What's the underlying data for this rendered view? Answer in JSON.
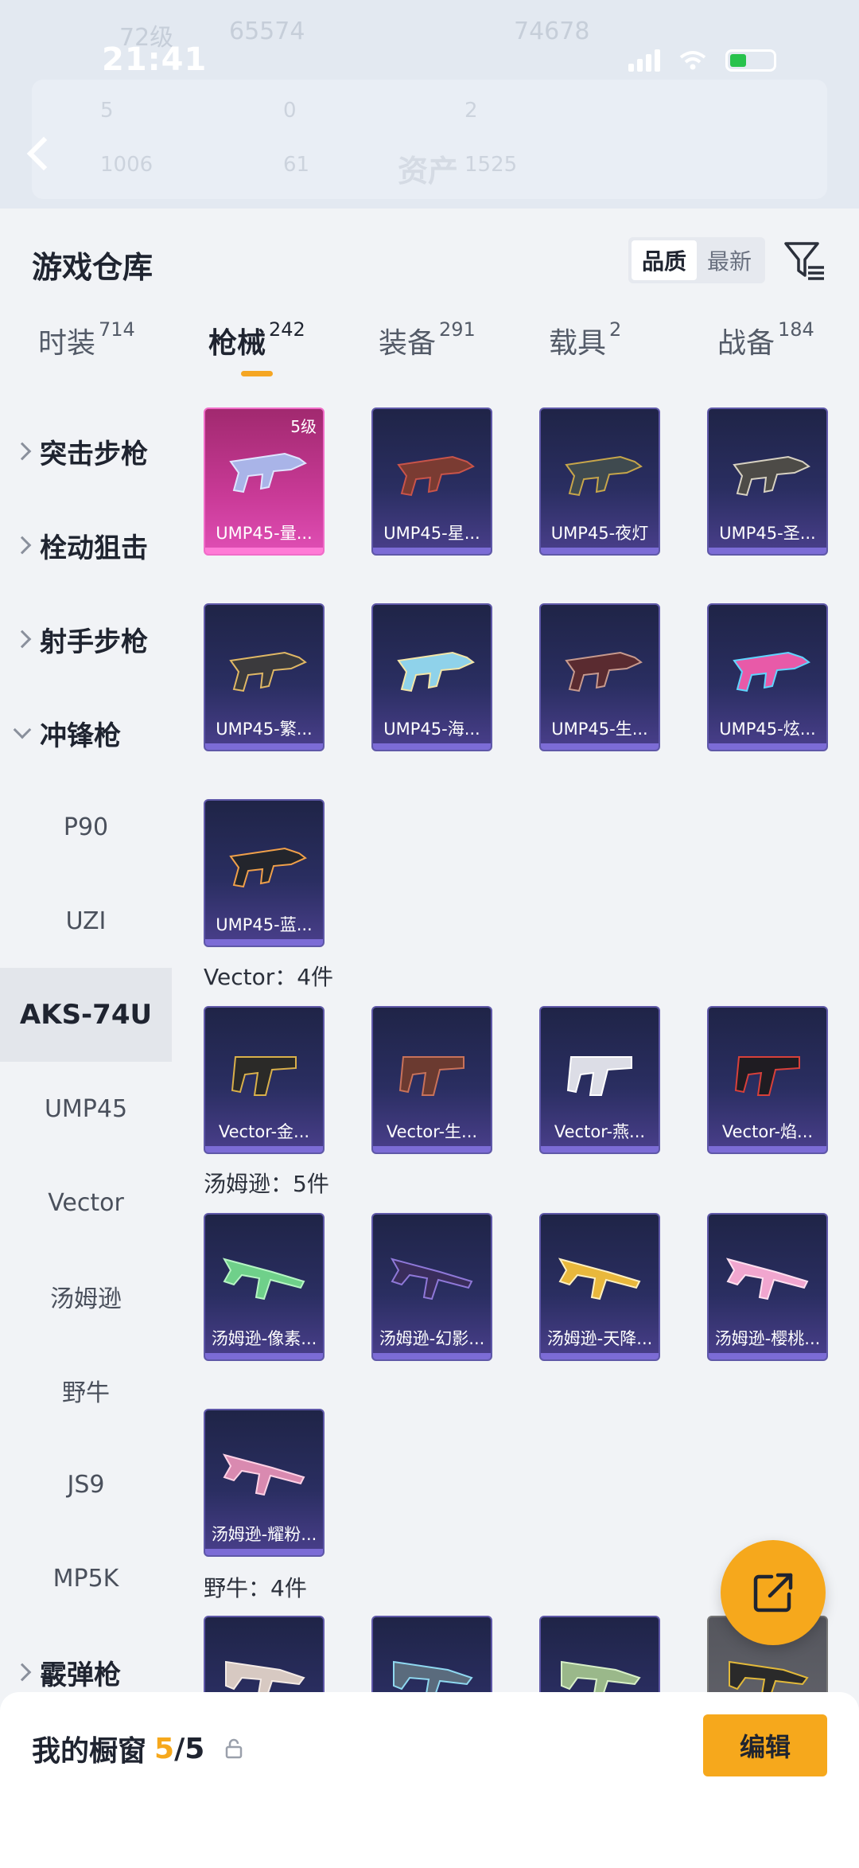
{
  "status": {
    "time": "21:41"
  },
  "background_header": {
    "line1_left": "72级",
    "line1_num": "65574",
    "line1_right": "74678",
    "stat1": "5",
    "stat2": "0",
    "stat3": "2",
    "stat4": "1006",
    "stat5": "61",
    "asset_label": "资产",
    "asset_value": "1525"
  },
  "sheet": {
    "title": "游戏仓库",
    "sort_options": [
      "品质",
      "最新"
    ],
    "tabs": [
      {
        "label": "时装",
        "count": "714"
      },
      {
        "label": "枪械",
        "count": "242"
      },
      {
        "label": "装备",
        "count": "291"
      },
      {
        "label": "载具",
        "count": "2"
      },
      {
        "label": "战备",
        "count": "184"
      }
    ]
  },
  "sidebar": {
    "categories": [
      {
        "label": "突击步枪"
      },
      {
        "label": "栓动狙击"
      },
      {
        "label": "射手步枪"
      },
      {
        "label": "冲锋枪"
      }
    ],
    "subcategories": [
      "P90",
      "UZI",
      "AKS-74U",
      "UMP45",
      "Vector",
      "汤姆逊",
      "野牛",
      "JS9",
      "MP5K"
    ],
    "bottom_category": "霰弹枪"
  },
  "content": {
    "ump_cards": [
      {
        "name": "UMP45-量...",
        "level": "5级"
      },
      {
        "name": "UMP45-星..."
      },
      {
        "name": "UMP45-夜灯"
      },
      {
        "name": "UMP45-圣..."
      },
      {
        "name": "UMP45-繁..."
      },
      {
        "name": "UMP45-海..."
      },
      {
        "name": "UMP45-生..."
      },
      {
        "name": "UMP45-炫..."
      },
      {
        "name": "UMP45-蓝..."
      }
    ],
    "vector_label": "Vector：4件",
    "vector_cards": [
      {
        "name": "Vector-金..."
      },
      {
        "name": "Vector-生..."
      },
      {
        "name": "Vector-燕..."
      },
      {
        "name": "Vector-焰..."
      }
    ],
    "thompson_label": "汤姆逊：5件",
    "thompson_cards": [
      {
        "name": "汤姆逊-像素..."
      },
      {
        "name": "汤姆逊-幻影..."
      },
      {
        "name": "汤姆逊-天降..."
      },
      {
        "name": "汤姆逊-樱桃..."
      },
      {
        "name": "汤姆逊-耀粉..."
      }
    ],
    "bizon_label": "野牛：4件"
  },
  "bottom_bar": {
    "title": "我的橱窗",
    "count_now": "5",
    "count_max": "/5",
    "edit_label": "编辑"
  },
  "colors": {
    "accent": "#f6a81c",
    "card_bg": "#2a2e61",
    "card_bar": "#7c6cd6",
    "rare_card": "#c93a97"
  }
}
